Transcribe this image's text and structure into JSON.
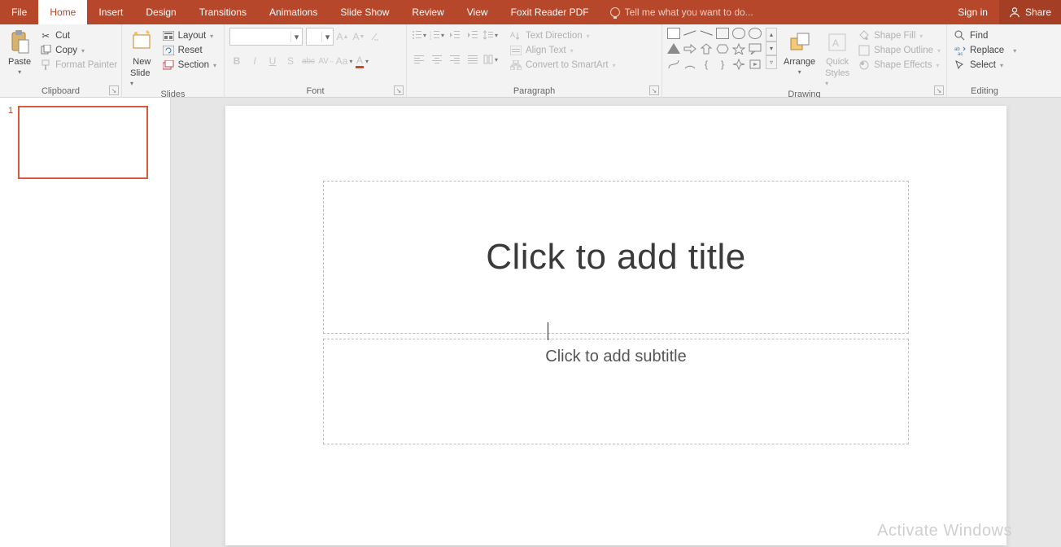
{
  "tabs": {
    "file": "File",
    "home": "Home",
    "insert": "Insert",
    "design": "Design",
    "transitions": "Transitions",
    "animations": "Animations",
    "slideshow": "Slide Show",
    "review": "Review",
    "view": "View",
    "foxit": "Foxit Reader PDF"
  },
  "title_bar": {
    "tell_me": "Tell me what you want to do...",
    "sign_in": "Sign in",
    "share": "Share"
  },
  "ribbon": {
    "clipboard": {
      "label": "Clipboard",
      "paste": "Paste",
      "cut": "Cut",
      "copy": "Copy",
      "format_painter": "Format Painter"
    },
    "slides": {
      "label": "Slides",
      "new_slide_line1": "New",
      "new_slide_line2": "Slide",
      "layout": "Layout",
      "reset": "Reset",
      "section": "Section"
    },
    "font": {
      "label": "Font",
      "font_name": "",
      "font_size": ""
    },
    "paragraph": {
      "label": "Paragraph",
      "text_direction": "Text Direction",
      "align_text": "Align Text",
      "convert_smartart": "Convert to SmartArt"
    },
    "drawing": {
      "label": "Drawing",
      "arrange": "Arrange",
      "quick_line1": "Quick",
      "quick_line2": "Styles",
      "shape_fill": "Shape Fill",
      "shape_outline": "Shape Outline",
      "shape_effects": "Shape Effects"
    },
    "editing": {
      "label": "Editing",
      "find": "Find",
      "replace": "Replace",
      "select": "Select"
    }
  },
  "slide_panel": {
    "thumb_number": "1"
  },
  "slide": {
    "title_placeholder": "Click to add title",
    "subtitle_placeholder": "Click to add subtitle"
  },
  "watermark": "Activate Windows"
}
